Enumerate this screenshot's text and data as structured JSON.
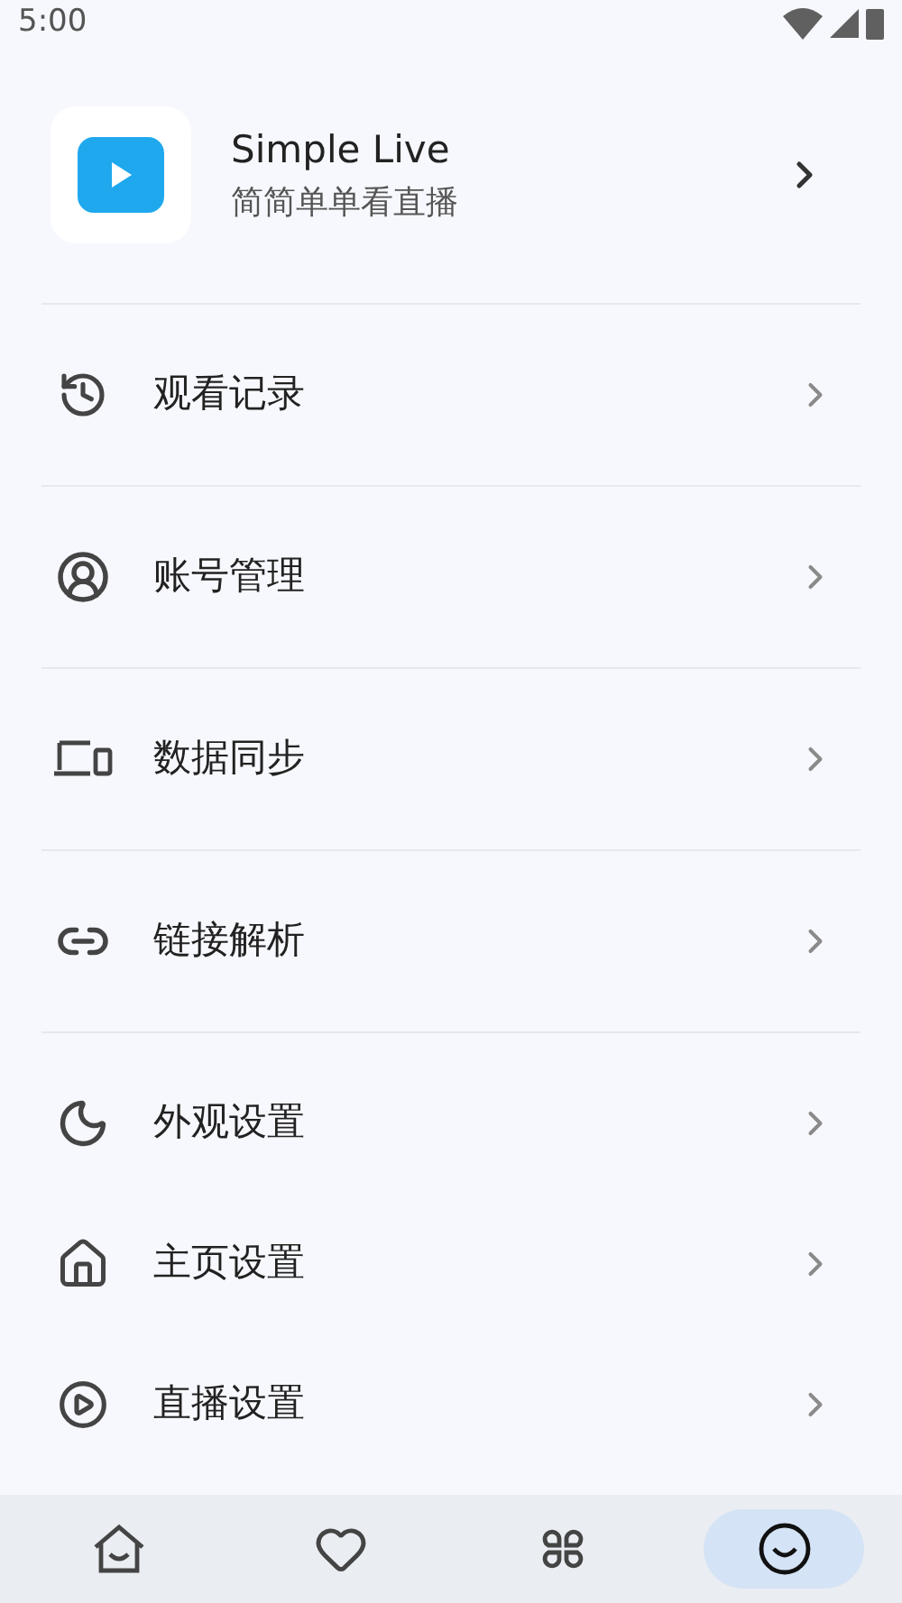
{
  "status_bar": {
    "time": "5:00"
  },
  "header": {
    "title": "Simple Live",
    "subtitle": "简简单单看直播"
  },
  "sections": [
    {
      "items": [
        {
          "kind": "history",
          "label": "观看记录"
        }
      ]
    },
    {
      "items": [
        {
          "kind": "account",
          "label": "账号管理"
        }
      ]
    },
    {
      "items": [
        {
          "kind": "devices",
          "label": "数据同步"
        }
      ]
    },
    {
      "items": [
        {
          "kind": "link",
          "label": "链接解析"
        }
      ]
    },
    {
      "items": [
        {
          "kind": "moon",
          "label": "外观设置"
        },
        {
          "kind": "home",
          "label": "主页设置"
        },
        {
          "kind": "play",
          "label": "直播设置"
        }
      ]
    }
  ],
  "nav": [
    {
      "kind": "home",
      "selected": false
    },
    {
      "kind": "heart",
      "selected": false
    },
    {
      "kind": "apps",
      "selected": false
    },
    {
      "kind": "smile",
      "selected": true
    }
  ]
}
